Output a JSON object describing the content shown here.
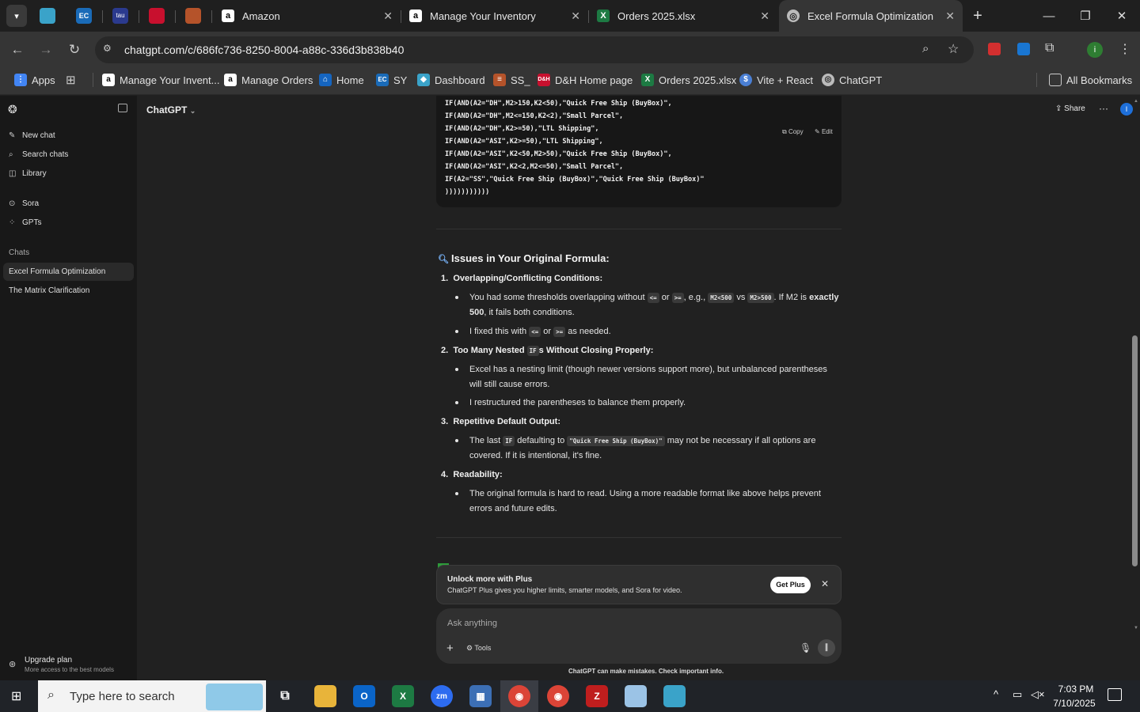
{
  "browser": {
    "tabs": [
      {
        "label": "Amazon"
      },
      {
        "label": "Manage Your Inventory"
      },
      {
        "label": "Orders 2025.xlsx"
      },
      {
        "label": "Excel Formula Optimization"
      }
    ],
    "url": "chatgpt.com/c/686fc736-8250-8004-a88c-336d3b838b40",
    "bookmarks": [
      {
        "label": "Apps"
      },
      {
        "label": "Manage Your Invent..."
      },
      {
        "label": "Manage Orders"
      },
      {
        "label": "Home"
      },
      {
        "label": "SY"
      },
      {
        "label": "Dashboard"
      },
      {
        "label": "SS_"
      },
      {
        "label": "D&H Home page"
      },
      {
        "label": "Orders 2025.xlsx"
      },
      {
        "label": "Vite + React"
      },
      {
        "label": "ChatGPT"
      }
    ],
    "all_bookmarks": "All Bookmarks"
  },
  "sidebar": {
    "nav": [
      {
        "label": "New chat"
      },
      {
        "label": "Search chats"
      },
      {
        "label": "Library"
      },
      {
        "label": "Sora"
      },
      {
        "label": "GPTs"
      }
    ],
    "section": "Chats",
    "chats": [
      {
        "label": "Excel Formula Optimization"
      },
      {
        "label": "The Matrix Clarification"
      }
    ],
    "upgrade": {
      "title": "Upgrade plan",
      "subtitle": "More access to the best models"
    }
  },
  "header": {
    "model": "ChatGPT",
    "share": "Share",
    "avatar": "I"
  },
  "code": {
    "copy": "Copy",
    "edit": "Edit",
    "lines": [
      "IF(AND(A2=\"DH\",M2>150,K2<50),\"Quick Free Ship (BuyBox)\",",
      "IF(AND(A2=\"DH\",M2<=150,K2<2),\"Small Parcel\",",
      "IF(AND(A2=\"DH\",K2>=50),\"LTL Shipping\",",
      "IF(AND(A2=\"ASI\",K2>=50),\"LTL Shipping\",",
      "IF(AND(A2=\"ASI\",K2<50,M2>50),\"Quick Free Ship (BuyBox)\",",
      "IF(AND(A2=\"ASI\",K2<2,M2<=50),\"Small Parcel\",",
      "IF(A2=\"SS\",\"Quick Free Ship (BuyBox)\",\"Quick Free Ship (BuyBox)\"",
      ")))))))))))"
    ]
  },
  "answer": {
    "heading": "Issues in Your Original Formula:",
    "items": [
      {
        "num": "1.",
        "title": "Overlapping/Conflicting Conditions:"
      },
      {
        "num": "2.",
        "title_pre": "Too Many Nested ",
        "title_code": "IF",
        "title_post": "s Without Closing Properly:"
      },
      {
        "num": "3.",
        "title": "Repetitive Default Output:"
      },
      {
        "num": "4.",
        "title": "Readability:"
      }
    ],
    "b1a": {
      "t1": "You had some thresholds overlapping without ",
      "c1": "<=",
      "t2": " or ",
      "c2": ">=",
      "t3": ", e.g., ",
      "c3": "M2<500",
      "t4": " vs ",
      "c4": "M2>500",
      "t5": ". If M2 is ",
      "bold": "exactly 500",
      "t6": ", it fails both conditions."
    },
    "b1b": {
      "t1": "I fixed this with ",
      "c1": "<=",
      "t2": " or ",
      "c2": ">=",
      "t3": " as needed."
    },
    "b2a": "Excel has a nesting limit (though newer versions support more), but unbalanced parentheses will still cause errors.",
    "b2b": "I restructured the parentheses to balance them properly.",
    "b3a": {
      "t1": "The last ",
      "c1": "IF",
      "t2": " defaulting to ",
      "c2": "\"Quick Free Ship (BuyBox)\"",
      "t3": " may not be necessary if all options are covered. If it is intentional, it's fine."
    },
    "b4a": "The original formula is hard to read. Using a more readable format like above helps prevent errors and future edits."
  },
  "banner": {
    "title": "Unlock more with Plus",
    "text": "ChatGPT Plus gives you higher limits, smarter models, and Sora for video.",
    "button": "Get Plus"
  },
  "composer": {
    "placeholder": "Ask anything",
    "tools": "Tools",
    "disclaimer": "ChatGPT can make mistakes. Check important info."
  },
  "taskbar": {
    "search_placeholder": "Type here to search",
    "time": "7:03 PM",
    "date": "7/10/2025"
  }
}
